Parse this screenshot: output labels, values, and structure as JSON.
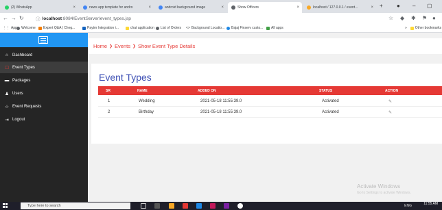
{
  "browser": {
    "tabs": [
      {
        "label": "(2) WhatsApp",
        "color": "#25d366",
        "active": false
      },
      {
        "label": "news app template for andro",
        "color": "#4285f4",
        "active": false
      },
      {
        "label": "android background image",
        "color": "#4285f4",
        "active": false
      },
      {
        "label": "Show Officers",
        "color": "#5f6368",
        "active": true
      },
      {
        "label": "localhost / 127.0.0.1 / event...",
        "color": "#f9a825",
        "active": false
      }
    ],
    "url_host": "localhost",
    "url_rest": ":8084/EventServer/event_types.jsp",
    "bookmarks": [
      {
        "label": "Apps",
        "color": "#5f6368"
      },
      {
        "label": "Welcome",
        "color": "#5f6368"
      },
      {
        "label": "Expert Q&A | Cheg...",
        "color": "#f57c00"
      },
      {
        "label": "Paytm Integration i...",
        "color": "#1565c0"
      },
      {
        "label": "chat application",
        "color": "#fdd835"
      },
      {
        "label": "List of Orders",
        "color": "#5f6368"
      },
      {
        "label": "Background Locatio...",
        "color": "#5f6368"
      },
      {
        "label": "Bajaj Finserv custo...",
        "color": "#1e88e5"
      },
      {
        "label": "All apps",
        "color": "#43a047"
      }
    ],
    "other_bookmarks": "Other bookmarks"
  },
  "sidebar": {
    "items": [
      {
        "label": "Dashboard",
        "icon": "home-icon",
        "glyph": "⌂",
        "active": false
      },
      {
        "label": "Event Types",
        "icon": "list-icon",
        "glyph": "☐",
        "active": true
      },
      {
        "label": "Packages",
        "icon": "package-icon",
        "glyph": "▬",
        "active": false
      },
      {
        "label": "Users",
        "icon": "users-icon",
        "glyph": "♟",
        "active": false
      },
      {
        "label": "Event Requests",
        "icon": "star-icon",
        "glyph": "☆",
        "active": false
      },
      {
        "label": "Logout",
        "icon": "logout-icon",
        "glyph": "⇥",
        "active": false
      }
    ]
  },
  "breadcrumb": {
    "home": "Home",
    "events": "Events",
    "current": "Show Event Type Details"
  },
  "page": {
    "title": "Event Types",
    "columns": {
      "sr": "SR",
      "name": "NAME",
      "added_on": "ADDED ON",
      "status": "STATUS",
      "action": "ACTION"
    },
    "rows": [
      {
        "sr": "1",
        "name": "Wedding",
        "added_on": "2021-05-18 11:55:39.0",
        "status": "Activated"
      },
      {
        "sr": "2",
        "name": "Birthday",
        "added_on": "2021-05-18 11:55:39.0",
        "status": "Activated"
      }
    ]
  },
  "watermark": {
    "title": "Activate Windows",
    "subtitle": "Go to Settings to activate Windows."
  },
  "taskbar": {
    "search_placeholder": "Type here to search",
    "time": "11:55 AM",
    "lang": "ENG"
  }
}
